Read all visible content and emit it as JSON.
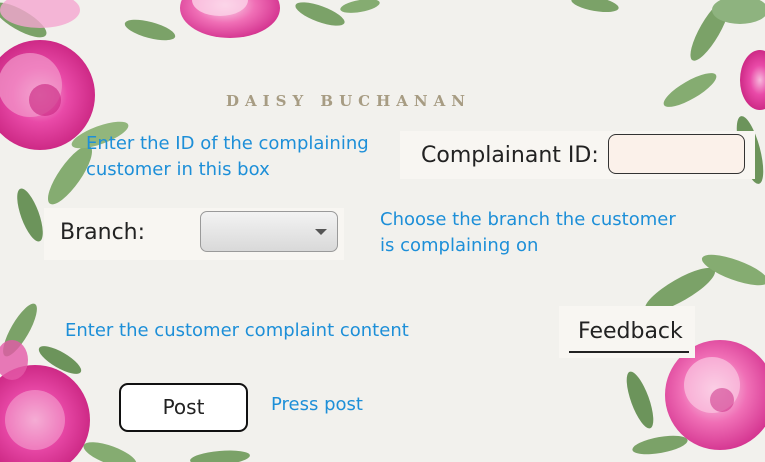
{
  "header": {
    "title": "DAISY BUCHANAN"
  },
  "hints": {
    "id_hint": "Enter the ID of the complaining customer in this box",
    "branch_hint": "Choose the branch the customer is complaining on",
    "complaint_hint": "Enter the customer complaint content",
    "post_hint": "Press post"
  },
  "form": {
    "complainant_id_label": "Complainant ID:",
    "complainant_id_value": "",
    "branch_label": "Branch:",
    "branch_value": "",
    "feedback_label": "Feedback",
    "post_label": "Post"
  },
  "colors": {
    "background": "#f2f1ed",
    "hint_text": "#1d8fd8",
    "title_text": "#a79c83",
    "flower_pink": "#e33fa2",
    "leaf_green": "#6f9a5a"
  },
  "icons": {
    "dropdown": "chevron-down-icon"
  }
}
